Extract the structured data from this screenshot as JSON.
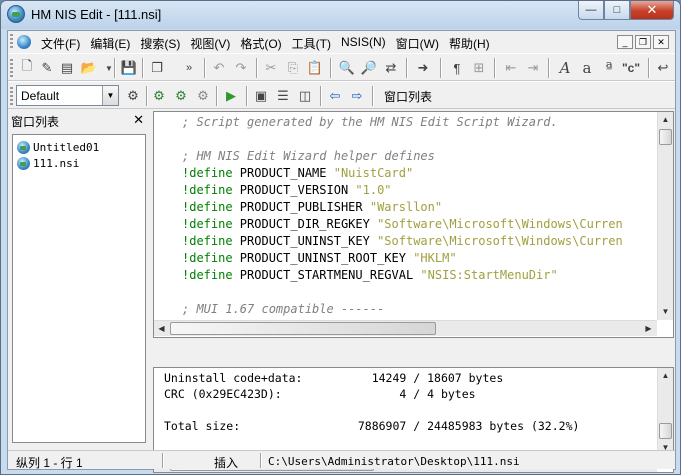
{
  "window": {
    "title": "HM NIS Edit - [111.nsi]",
    "min_glyph": "—",
    "max_glyph": "□",
    "close_glyph": "✕"
  },
  "menu": {
    "items": [
      "文件(F)",
      "编辑(E)",
      "搜索(S)",
      "视图(V)",
      "格式(O)",
      "工具(T)",
      "NSIS(N)",
      "窗口(W)",
      "帮助(H)"
    ],
    "mdi_min": "_",
    "mdi_restore": "❐",
    "mdi_close": "✕"
  },
  "toolbar2": {
    "combo_value": "Default",
    "window_list_label": "窗口列表"
  },
  "side_panel": {
    "title": "窗口列表",
    "close_glyph": "✕",
    "files": [
      "Untitled01",
      "111.nsi"
    ]
  },
  "editor": {
    "lines": [
      [
        {
          "t": "; Script generated by the HM NIS Edit Script Wizard.",
          "c": "comment"
        }
      ],
      [
        {
          "t": "",
          "c": "plain"
        }
      ],
      [
        {
          "t": "; HM NIS Edit Wizard helper defines",
          "c": "comment"
        }
      ],
      [
        {
          "t": "!define",
          "c": "kw"
        },
        {
          "t": " PRODUCT_NAME ",
          "c": "plain"
        },
        {
          "t": "\"NuistCard\"",
          "c": "str"
        }
      ],
      [
        {
          "t": "!define",
          "c": "kw"
        },
        {
          "t": " PRODUCT_VERSION ",
          "c": "plain"
        },
        {
          "t": "\"1.0\"",
          "c": "str"
        }
      ],
      [
        {
          "t": "!define",
          "c": "kw"
        },
        {
          "t": " PRODUCT_PUBLISHER ",
          "c": "plain"
        },
        {
          "t": "\"Warsllon\"",
          "c": "str"
        }
      ],
      [
        {
          "t": "!define",
          "c": "kw"
        },
        {
          "t": " PRODUCT_DIR_REGKEY ",
          "c": "plain"
        },
        {
          "t": "\"Software\\Microsoft\\Windows\\Curren",
          "c": "str"
        }
      ],
      [
        {
          "t": "!define",
          "c": "kw"
        },
        {
          "t": " PRODUCT_UNINST_KEY ",
          "c": "plain"
        },
        {
          "t": "\"Software\\Microsoft\\Windows\\Curren",
          "c": "str"
        }
      ],
      [
        {
          "t": "!define",
          "c": "kw"
        },
        {
          "t": " PRODUCT_UNINST_ROOT_KEY ",
          "c": "plain"
        },
        {
          "t": "\"HKLM\"",
          "c": "str"
        }
      ],
      [
        {
          "t": "!define",
          "c": "kw"
        },
        {
          "t": " PRODUCT_STARTMENU_REGVAL ",
          "c": "plain"
        },
        {
          "t": "\"NSIS:StartMenuDir\"",
          "c": "str"
        }
      ],
      [
        {
          "t": "",
          "c": "plain"
        }
      ],
      [
        {
          "t": "; MUI 1.67 compatible ------",
          "c": "comment"
        }
      ]
    ]
  },
  "output": {
    "lines": [
      "Uninstall code+data:          14249 / 18607 bytes",
      "CRC (0x29EC423D):                 4 / 4 bytes",
      "",
      "Total size:                 7886907 / 24485983 bytes (32.2%)"
    ]
  },
  "statusbar": {
    "position": "纵列 1 - 行 1",
    "mode": "插入",
    "path": "C:\\Users\\Administrator\\Desktop\\111.nsi"
  }
}
